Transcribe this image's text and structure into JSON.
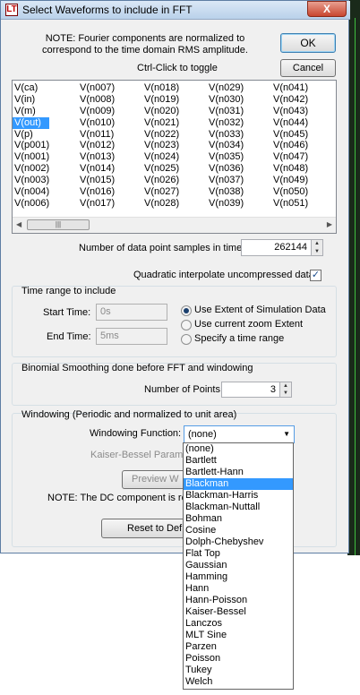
{
  "window": {
    "title": "Select Waveforms to include in FFT",
    "close_label": "X"
  },
  "note": {
    "line1": "NOTE:  Fourier components are normalized to",
    "line2": "correspond to the time domain RMS amplitude."
  },
  "ok_label": "OK",
  "cancel_label": "Cancel",
  "ctrl_hint": "Ctrl-Click to toggle",
  "waveforms": {
    "columns": [
      [
        "V(ca)",
        "V(in)",
        "V(m)",
        "V(out)",
        "V(p)",
        "V(p001)",
        "V(n001)",
        "V(n002)",
        "V(n003)",
        "V(n004)",
        "V(n006)"
      ],
      [
        "V(n007)",
        "V(n008)",
        "V(n009)",
        "V(n010)",
        "V(n011)",
        "V(n012)",
        "V(n013)",
        "V(n014)",
        "V(n015)",
        "V(n016)",
        "V(n017)"
      ],
      [
        "V(n018)",
        "V(n019)",
        "V(n020)",
        "V(n021)",
        "V(n022)",
        "V(n023)",
        "V(n024)",
        "V(n025)",
        "V(n026)",
        "V(n027)",
        "V(n028)"
      ],
      [
        "V(n029)",
        "V(n030)",
        "V(n031)",
        "V(n032)",
        "V(n033)",
        "V(n034)",
        "V(n035)",
        "V(n036)",
        "V(n037)",
        "V(n038)",
        "V(n039)"
      ],
      [
        "V(n041)",
        "V(n042)",
        "V(n043)",
        "V(n044)",
        "V(n045)",
        "V(n046)",
        "V(n047)",
        "V(n048)",
        "V(n049)",
        "V(n050)",
        "V(n051)"
      ]
    ],
    "selected": "V(out)",
    "scroll_thumb_glyph": "|||"
  },
  "samples": {
    "label": "Number of data point samples in time:",
    "value": "262144"
  },
  "quadratic": {
    "label": "Quadratic interpolate uncompressed data",
    "checked": true,
    "check_glyph": "✓"
  },
  "time_range": {
    "title": "Time range to include",
    "start_label": "Start Time:",
    "start_value": "0s",
    "end_label": "End Time:",
    "end_value": "5ms",
    "options": [
      "Use Extent of Simulation Data",
      "Use current zoom Extent",
      "Specify a time range"
    ],
    "selected_option": "Use Extent of Simulation Data"
  },
  "smoothing": {
    "title": "Binomial Smoothing done before FFT and windowing",
    "points_label": "Number of Points:",
    "points_value": "3"
  },
  "windowing": {
    "title": "Windowing  (Periodic and normalized to unit area)",
    "function_label": "Windowing Function:",
    "function_value": "(none)",
    "kaiser_label": "Kaiser-Bessel Parame",
    "preview_label": "Preview W",
    "dc_note": "NOTE:  The DC component is re",
    "reset_label": "Reset to Def",
    "options": [
      "(none)",
      "Bartlett",
      "Bartlett-Hann",
      "Blackman",
      "Blackman-Harris",
      "Blackman-Nuttall",
      "Bohman",
      "Cosine",
      "Dolph-Chebyshev",
      "Flat Top",
      "Gaussian",
      "Hamming",
      "Hann",
      "Hann-Poisson",
      "Kaiser-Bessel",
      "Lanczos",
      "MLT Sine",
      "Parzen",
      "Poisson",
      "Tukey",
      "Welch"
    ],
    "highlighted": "Blackman"
  },
  "colors": {
    "selection": "#3399ff",
    "titlebar": "#c9dcf0",
    "close_button": "#c8452f"
  }
}
